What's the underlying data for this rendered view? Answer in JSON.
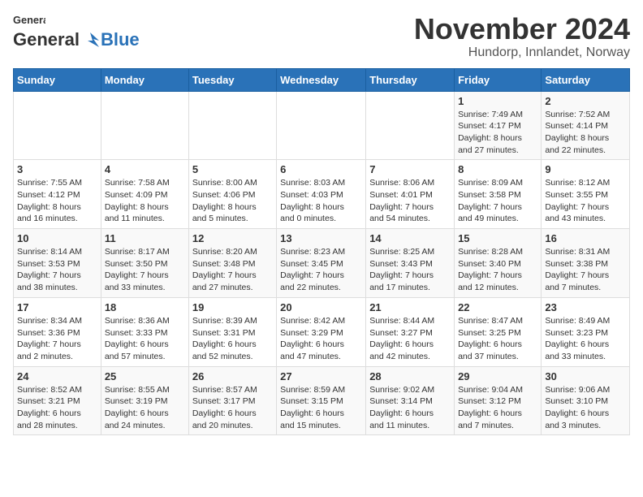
{
  "header": {
    "logo_general": "General",
    "logo_blue": "Blue",
    "title": "November 2024",
    "subtitle": "Hundorp, Innlandet, Norway"
  },
  "weekdays": [
    "Sunday",
    "Monday",
    "Tuesday",
    "Wednesday",
    "Thursday",
    "Friday",
    "Saturday"
  ],
  "weeks": [
    [
      {
        "day": "",
        "info": ""
      },
      {
        "day": "",
        "info": ""
      },
      {
        "day": "",
        "info": ""
      },
      {
        "day": "",
        "info": ""
      },
      {
        "day": "",
        "info": ""
      },
      {
        "day": "1",
        "info": "Sunrise: 7:49 AM\nSunset: 4:17 PM\nDaylight: 8 hours\nand 27 minutes."
      },
      {
        "day": "2",
        "info": "Sunrise: 7:52 AM\nSunset: 4:14 PM\nDaylight: 8 hours\nand 22 minutes."
      }
    ],
    [
      {
        "day": "3",
        "info": "Sunrise: 7:55 AM\nSunset: 4:12 PM\nDaylight: 8 hours\nand 16 minutes."
      },
      {
        "day": "4",
        "info": "Sunrise: 7:58 AM\nSunset: 4:09 PM\nDaylight: 8 hours\nand 11 minutes."
      },
      {
        "day": "5",
        "info": "Sunrise: 8:00 AM\nSunset: 4:06 PM\nDaylight: 8 hours\nand 5 minutes."
      },
      {
        "day": "6",
        "info": "Sunrise: 8:03 AM\nSunset: 4:03 PM\nDaylight: 8 hours\nand 0 minutes."
      },
      {
        "day": "7",
        "info": "Sunrise: 8:06 AM\nSunset: 4:01 PM\nDaylight: 7 hours\nand 54 minutes."
      },
      {
        "day": "8",
        "info": "Sunrise: 8:09 AM\nSunset: 3:58 PM\nDaylight: 7 hours\nand 49 minutes."
      },
      {
        "day": "9",
        "info": "Sunrise: 8:12 AM\nSunset: 3:55 PM\nDaylight: 7 hours\nand 43 minutes."
      }
    ],
    [
      {
        "day": "10",
        "info": "Sunrise: 8:14 AM\nSunset: 3:53 PM\nDaylight: 7 hours\nand 38 minutes."
      },
      {
        "day": "11",
        "info": "Sunrise: 8:17 AM\nSunset: 3:50 PM\nDaylight: 7 hours\nand 33 minutes."
      },
      {
        "day": "12",
        "info": "Sunrise: 8:20 AM\nSunset: 3:48 PM\nDaylight: 7 hours\nand 27 minutes."
      },
      {
        "day": "13",
        "info": "Sunrise: 8:23 AM\nSunset: 3:45 PM\nDaylight: 7 hours\nand 22 minutes."
      },
      {
        "day": "14",
        "info": "Sunrise: 8:25 AM\nSunset: 3:43 PM\nDaylight: 7 hours\nand 17 minutes."
      },
      {
        "day": "15",
        "info": "Sunrise: 8:28 AM\nSunset: 3:40 PM\nDaylight: 7 hours\nand 12 minutes."
      },
      {
        "day": "16",
        "info": "Sunrise: 8:31 AM\nSunset: 3:38 PM\nDaylight: 7 hours\nand 7 minutes."
      }
    ],
    [
      {
        "day": "17",
        "info": "Sunrise: 8:34 AM\nSunset: 3:36 PM\nDaylight: 7 hours\nand 2 minutes."
      },
      {
        "day": "18",
        "info": "Sunrise: 8:36 AM\nSunset: 3:33 PM\nDaylight: 6 hours\nand 57 minutes."
      },
      {
        "day": "19",
        "info": "Sunrise: 8:39 AM\nSunset: 3:31 PM\nDaylight: 6 hours\nand 52 minutes."
      },
      {
        "day": "20",
        "info": "Sunrise: 8:42 AM\nSunset: 3:29 PM\nDaylight: 6 hours\nand 47 minutes."
      },
      {
        "day": "21",
        "info": "Sunrise: 8:44 AM\nSunset: 3:27 PM\nDaylight: 6 hours\nand 42 minutes."
      },
      {
        "day": "22",
        "info": "Sunrise: 8:47 AM\nSunset: 3:25 PM\nDaylight: 6 hours\nand 37 minutes."
      },
      {
        "day": "23",
        "info": "Sunrise: 8:49 AM\nSunset: 3:23 PM\nDaylight: 6 hours\nand 33 minutes."
      }
    ],
    [
      {
        "day": "24",
        "info": "Sunrise: 8:52 AM\nSunset: 3:21 PM\nDaylight: 6 hours\nand 28 minutes."
      },
      {
        "day": "25",
        "info": "Sunrise: 8:55 AM\nSunset: 3:19 PM\nDaylight: 6 hours\nand 24 minutes."
      },
      {
        "day": "26",
        "info": "Sunrise: 8:57 AM\nSunset: 3:17 PM\nDaylight: 6 hours\nand 20 minutes."
      },
      {
        "day": "27",
        "info": "Sunrise: 8:59 AM\nSunset: 3:15 PM\nDaylight: 6 hours\nand 15 minutes."
      },
      {
        "day": "28",
        "info": "Sunrise: 9:02 AM\nSunset: 3:14 PM\nDaylight: 6 hours\nand 11 minutes."
      },
      {
        "day": "29",
        "info": "Sunrise: 9:04 AM\nSunset: 3:12 PM\nDaylight: 6 hours\nand 7 minutes."
      },
      {
        "day": "30",
        "info": "Sunrise: 9:06 AM\nSunset: 3:10 PM\nDaylight: 6 hours\nand 3 minutes."
      }
    ]
  ]
}
